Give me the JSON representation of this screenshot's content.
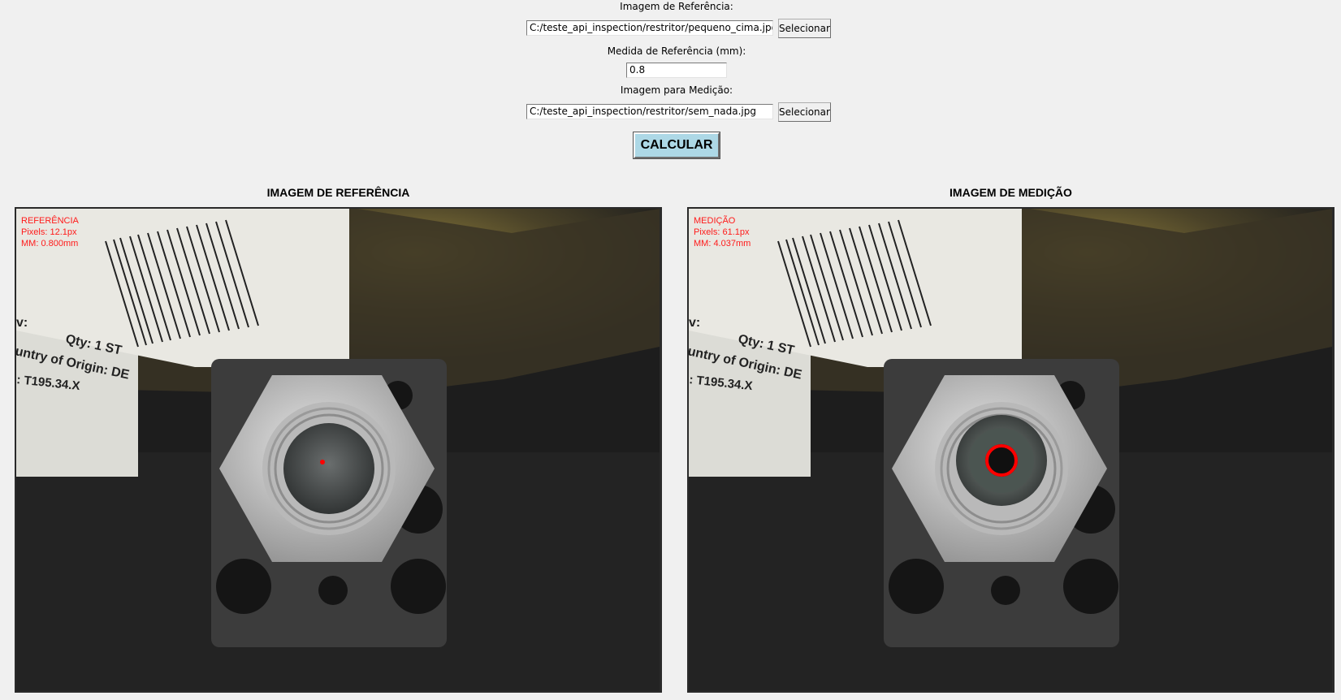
{
  "form": {
    "reference_image_label": "Imagem de Referência:",
    "reference_image_path": "C:/teste_api_inspection/restritor/pequeno_cima.jpg",
    "reference_select_label": "Selecionar",
    "reference_measure_label": "Medida de Referência (mm):",
    "reference_measure_value": "0.8",
    "measure_image_label": "Imagem para Medição:",
    "measure_image_path": "C:/teste_api_inspection/restritor/sem_nada.jpg",
    "measure_select_label": "Selecionar",
    "calculate_label": "CALCULAR"
  },
  "panels": {
    "reference": {
      "title": "IMAGEM DE REFERÊNCIA",
      "overlay_line1": "REFERÊNCIA",
      "overlay_line2": "Pixels: 12.1px",
      "overlay_line3": "MM: 0.800mm"
    },
    "measurement": {
      "title": "IMAGEM DE MEDIÇÃO",
      "overlay_line1": "MEDIÇÃO",
      "overlay_line2": "Pixels: 61.1px",
      "overlay_line3": "MM: 4.037mm"
    }
  },
  "photo_text": {
    "qty": "Qty: 1 ST",
    "origin": "untry of Origin: DE",
    "part": ": T195.34.X",
    "rev": "v:"
  },
  "colors": {
    "background": "#f0f0f0",
    "calculate_button": "#add8e6",
    "overlay_text": "#ff1a1a",
    "measurement_circle": "#ff0000"
  }
}
